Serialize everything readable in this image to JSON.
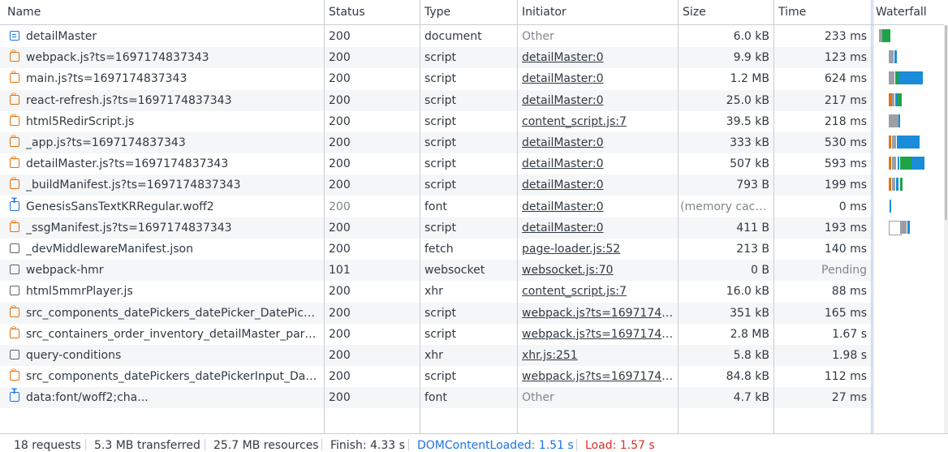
{
  "columns": [
    "Name",
    "Status",
    "Type",
    "Initiator",
    "Size",
    "Time",
    "Waterfall"
  ],
  "rows": [
    {
      "name": "detailMaster",
      "icon": "document-icon",
      "status": "200",
      "type": "document",
      "initiator": "Other",
      "initiator_link": false,
      "size": "6.0 kB",
      "time": "233 ms"
    },
    {
      "name": "webpack.js?ts=1697174837343",
      "icon": "script-icon",
      "status": "200",
      "type": "script",
      "initiator": "detailMaster:0",
      "initiator_link": true,
      "size": "9.9 kB",
      "time": "123 ms"
    },
    {
      "name": "main.js?ts=1697174837343",
      "icon": "script-icon",
      "status": "200",
      "type": "script",
      "initiator": "detailMaster:0",
      "initiator_link": true,
      "size": "1.2 MB",
      "time": "624 ms"
    },
    {
      "name": "react-refresh.js?ts=1697174837343",
      "icon": "script-icon",
      "status": "200",
      "type": "script",
      "initiator": "detailMaster:0",
      "initiator_link": true,
      "size": "25.0 kB",
      "time": "217 ms"
    },
    {
      "name": "html5RedirScript.js",
      "icon": "script-icon",
      "status": "200",
      "type": "script",
      "initiator": "content_script.js:7",
      "initiator_link": true,
      "size": "39.5 kB",
      "time": "218 ms"
    },
    {
      "name": "_app.js?ts=1697174837343",
      "icon": "script-icon",
      "status": "200",
      "type": "script",
      "initiator": "detailMaster:0",
      "initiator_link": true,
      "size": "333 kB",
      "time": "530 ms"
    },
    {
      "name": "detailMaster.js?ts=1697174837343",
      "icon": "script-icon",
      "status": "200",
      "type": "script",
      "initiator": "detailMaster:0",
      "initiator_link": true,
      "size": "507 kB",
      "time": "593 ms"
    },
    {
      "name": "_buildManifest.js?ts=1697174837343",
      "icon": "script-icon",
      "status": "200",
      "type": "script",
      "initiator": "detailMaster:0",
      "initiator_link": true,
      "size": "793 B",
      "time": "199 ms"
    },
    {
      "name": "GenesisSansTextKRRegular.woff2",
      "icon": "font-icon",
      "status": "200",
      "status_muted": true,
      "type": "font",
      "initiator": "detailMaster:0",
      "initiator_link": true,
      "size": "(memory cache)",
      "size_muted": true,
      "time": "0 ms"
    },
    {
      "name": "_ssgManifest.js?ts=1697174837343",
      "icon": "script-icon",
      "status": "200",
      "type": "script",
      "initiator": "detailMaster:0",
      "initiator_link": true,
      "size": "411 B",
      "time": "193 ms"
    },
    {
      "name": "_devMiddlewareManifest.json",
      "icon": "other-icon",
      "status": "200",
      "type": "fetch",
      "initiator": "page-loader.js:52",
      "initiator_link": true,
      "size": "213 B",
      "time": "140 ms"
    },
    {
      "name": "webpack-hmr",
      "icon": "other-icon",
      "status": "101",
      "type": "websocket",
      "initiator": "websocket.js:70",
      "initiator_link": true,
      "size": "0 B",
      "time": "Pending",
      "time_muted": true
    },
    {
      "name": "html5mmrPlayer.js",
      "icon": "other-icon",
      "status": "200",
      "type": "xhr",
      "initiator": "content_script.js:7",
      "initiator_link": true,
      "size": "16.0 kB",
      "time": "88 ms"
    },
    {
      "name": "src_components_datePickers_datePicker_DatePicker_...",
      "icon": "script-icon",
      "status": "200",
      "type": "script",
      "initiator": "webpack.js?ts=169717483...",
      "initiator_link": true,
      "size": "351 kB",
      "time": "165 ms"
    },
    {
      "name": "src_containers_order_inventory_detailMaster_parts_d...",
      "icon": "script-icon",
      "status": "200",
      "type": "script",
      "initiator": "webpack.js?ts=169717483...",
      "initiator_link": true,
      "size": "2.8 MB",
      "time": "1.67 s"
    },
    {
      "name": "query-conditions",
      "icon": "other-icon",
      "status": "200",
      "type": "xhr",
      "initiator": "xhr.js:251",
      "initiator_link": true,
      "size": "5.8 kB",
      "time": "1.98 s"
    },
    {
      "name": "src_components_datePickers_datePickerInput_DatePi...",
      "icon": "script-icon",
      "status": "200",
      "type": "script",
      "initiator": "webpack.js?ts=169717483...",
      "initiator_link": true,
      "size": "84.8 kB",
      "time": "112 ms"
    },
    {
      "name": "data:font/woff2;cha...",
      "icon": "font-icon",
      "status": "200",
      "type": "font",
      "initiator": "Other",
      "initiator_link": false,
      "size": "4.7 kB",
      "time": "27 ms"
    }
  ],
  "footer": {
    "requests": "18 requests",
    "transferred": "5.3 MB transferred",
    "resources": "25.7 MB resources",
    "finish": "Finish: 4.33 s",
    "dom_content_loaded": "DOMContentLoaded: 1.51 s",
    "load": "Load: 1.57 s"
  },
  "colors": {
    "link": "#303942",
    "dcl": "#1a73e8",
    "load": "#d93025",
    "waiting": "#9aa0a6",
    "download": "#1a8cd8",
    "green": "#1ea446",
    "orange": "#e8710a"
  }
}
